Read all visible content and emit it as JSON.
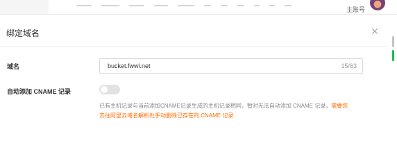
{
  "header": {
    "account_label": "主账号"
  },
  "dialog": {
    "title": "绑定域名",
    "close_icon": "close-icon"
  },
  "form": {
    "domain": {
      "label": "域名",
      "value": "bucket.fwwl.net",
      "char_count": "15/63"
    },
    "auto_cname": {
      "label": "自动添加 CNAME 记录",
      "enabled": false,
      "help_gray_line": "已有主机记录与当前添加CNAME记录生成的主机记录相同，暂时无法自动添加 CNAME 记录，",
      "help_orange_1": "需要您",
      "help_orange_2": "去往阿里云域名解析处手动删除已存在的 CNAME 记录"
    }
  },
  "colors": {
    "accent_orange": "#ff6a00",
    "scroll_indicator_green": "#1db954"
  }
}
